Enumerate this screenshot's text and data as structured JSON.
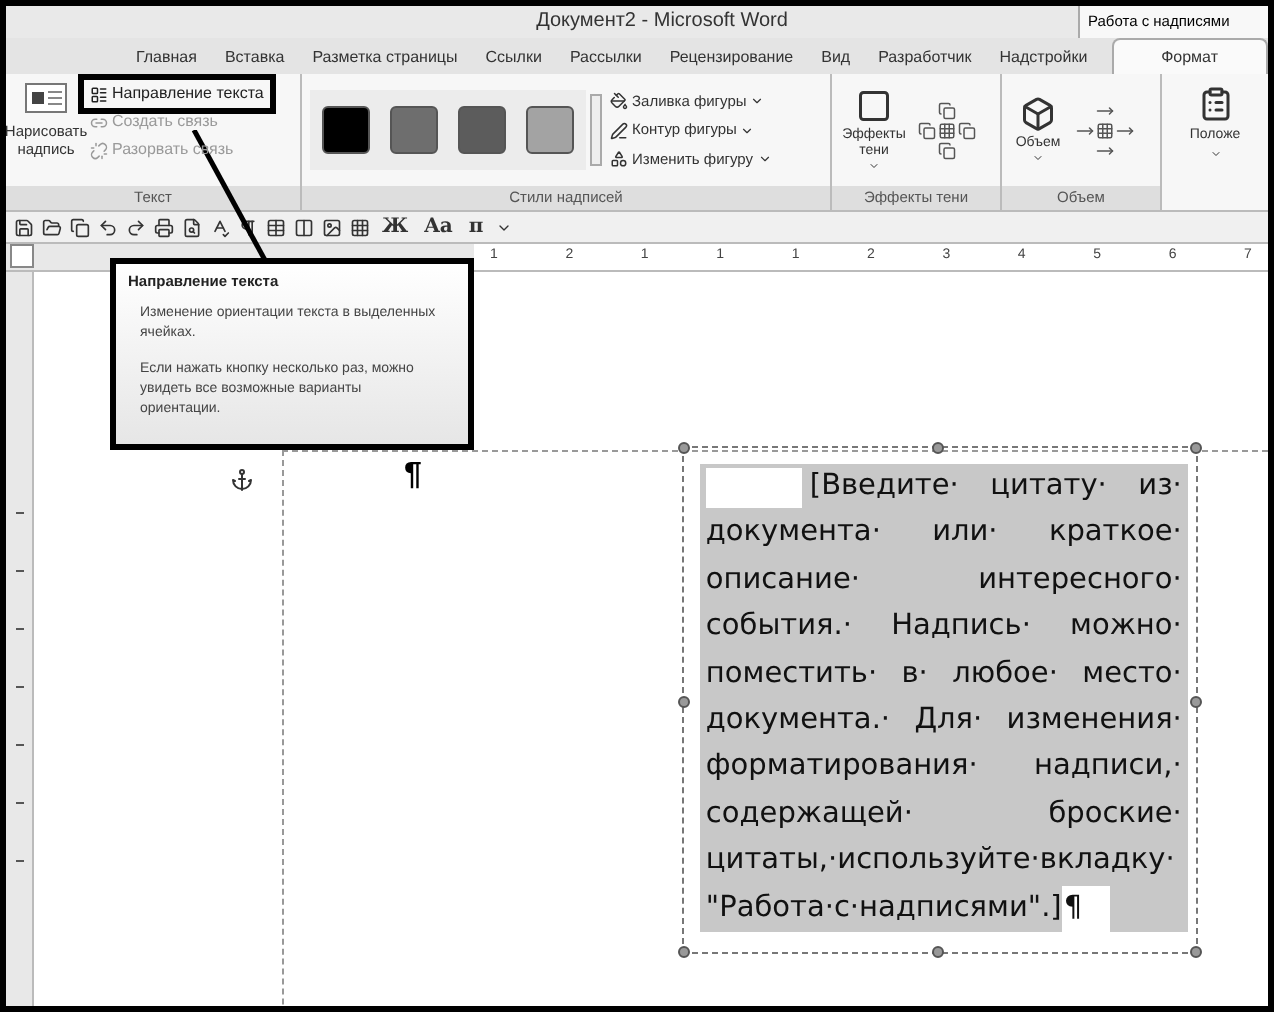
{
  "window": {
    "title": "Документ2 - Microsoft Word",
    "context_title": "Работа с надписями"
  },
  "tabs": [
    {
      "label": "Главная",
      "selected": false
    },
    {
      "label": "Вставка",
      "selected": false
    },
    {
      "label": "Разметка страницы",
      "selected": false
    },
    {
      "label": "Ссылки",
      "selected": false
    },
    {
      "label": "Рассылки",
      "selected": false
    },
    {
      "label": "Рецензирование",
      "selected": false
    },
    {
      "label": "Вид",
      "selected": false
    },
    {
      "label": "Разработчик",
      "selected": false
    },
    {
      "label": "Надстройки",
      "selected": false
    },
    {
      "label": "Формат",
      "selected": true
    }
  ],
  "text_group": {
    "label": "Текст",
    "draw_button": "Нарисовать надпись",
    "commands": [
      {
        "label": "Направление текста",
        "disabled": false,
        "highlighted": true
      },
      {
        "label": "Создать связь",
        "disabled": true,
        "highlighted": false
      },
      {
        "label": "Разорвать связь",
        "disabled": true,
        "highlighted": false
      }
    ]
  },
  "styles_group": {
    "label": "Стили надписей",
    "swatches": [
      {
        "color": "#000000"
      },
      {
        "color": "#6e6e6e"
      },
      {
        "color": "#5c5c5c"
      },
      {
        "color": "#a3a3a3"
      }
    ],
    "commands": [
      "Заливка фигуры",
      "Контур фигуры",
      "Изменить фигуру"
    ]
  },
  "shadow_group": {
    "label": "Эффекты тени",
    "button": "Эффекты тени"
  },
  "volume_group": {
    "label": "Объем",
    "button": "Объем"
  },
  "position_group": {
    "button": "Положе"
  },
  "toolbar": {
    "glyphs": [
      "Ж",
      "Aa",
      "π"
    ]
  },
  "ruler": {
    "labels": [
      "1",
      "2",
      "1",
      "1",
      "1",
      "2",
      "3",
      "4",
      "5",
      "6",
      "7"
    ]
  },
  "tooltip": {
    "title": "Направление текста",
    "paragraphs": [
      "Изменение ориентации текста в выделенных ячейках.",
      "Если нажать кнопку несколько раз, можно увидеть все возможные варианты ориентации."
    ]
  },
  "document": {
    "pilcrow": "¶",
    "textbox": {
      "lines": [
        "[Введите· цитату· из·",
        "документа· или· краткое·",
        "описание· интересного·",
        "события.· Надпись· можно·",
        "поместить· в· любое· место·",
        "документа.· Для· изменения·",
        "форматирования· надписи,·",
        "содержащей· броские·",
        "цитаты,·используйте·вкладку·",
        "\"Работа·с·надписями\".]"
      ],
      "end_mark": "¶"
    }
  }
}
